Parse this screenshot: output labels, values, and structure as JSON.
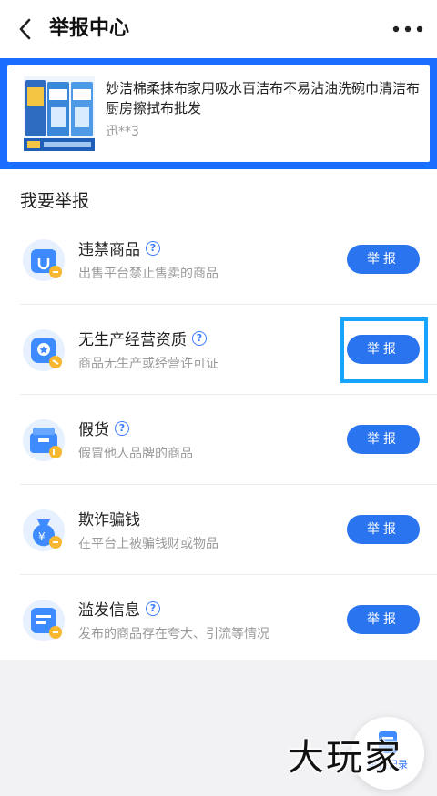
{
  "header": {
    "title": "举报中心",
    "back_icon": "chevron-left-icon",
    "more_icon": "more-dots-icon"
  },
  "product": {
    "title": "妙洁棉柔抹布家用吸水百洁布不易沾油洗碗巾清洁布厨房擦拭布批发",
    "seller": "迅**3"
  },
  "section": {
    "title": "我要举报"
  },
  "categories": [
    {
      "name": "违禁商品",
      "desc": "出售平台禁止售卖的商品",
      "button": "举报",
      "icon": "bag-icon"
    },
    {
      "name": "无生产经营资质",
      "desc": "商品无生产或经营许可证",
      "button": "举报",
      "icon": "badge-icon"
    },
    {
      "name": "假货",
      "desc": "假冒他人品牌的商品",
      "button": "举报",
      "icon": "box-icon"
    },
    {
      "name": "欺诈骗钱",
      "desc": "在平台上被骗钱财或物品",
      "button": "举报",
      "icon": "money-bag-icon"
    },
    {
      "name": "滥发信息",
      "desc": "发布的商品存在夸大、引流等情况",
      "button": "举报",
      "icon": "document-icon"
    }
  ],
  "fab": {
    "label": "举报记录"
  },
  "watermark": {
    "text": "大玩家"
  },
  "colors": {
    "accent": "#2a74ef",
    "highlight": "#17a4ff",
    "frame": "#1a6dff"
  }
}
